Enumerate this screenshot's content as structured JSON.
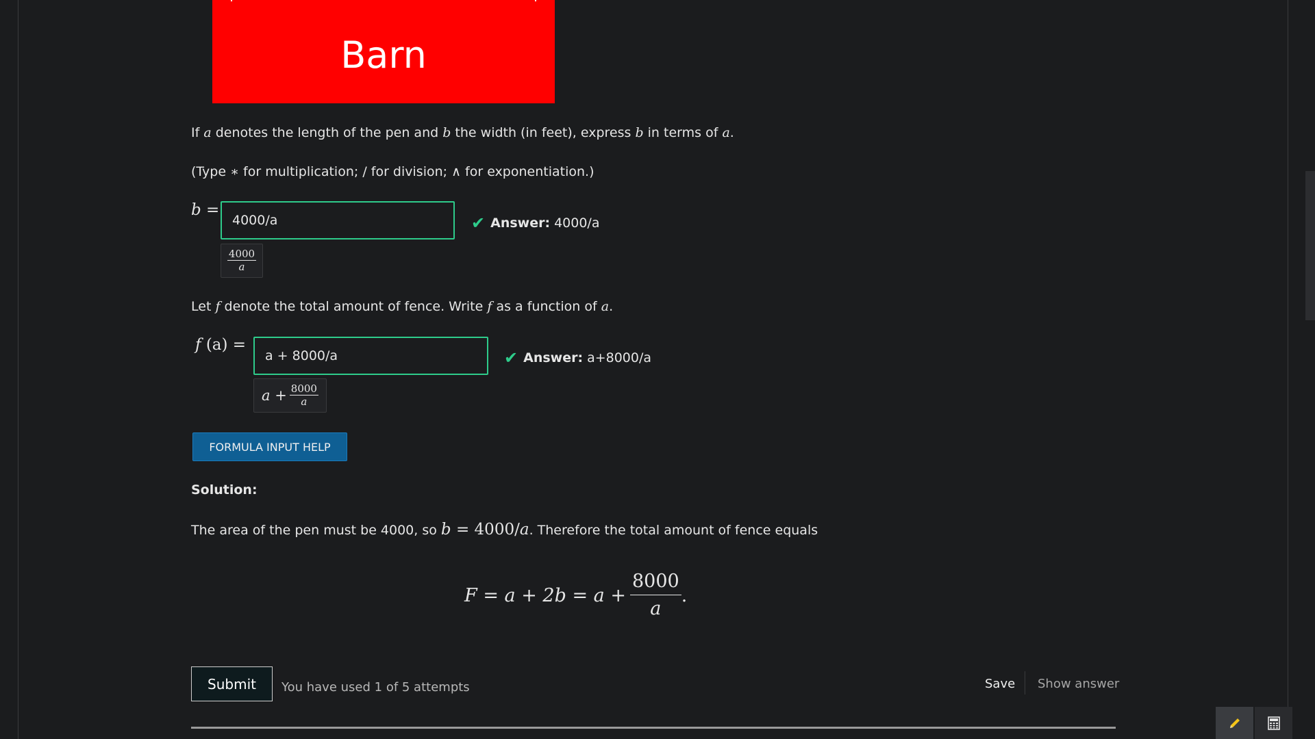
{
  "figure": {
    "label": "Barn"
  },
  "question1": {
    "prefix": "If ",
    "var_a": "a",
    "mid1": " denotes the length of the pen and ",
    "var_b": "b",
    "mid2": " the width (in feet), express ",
    "var_b2": "b",
    "mid3": " in terms of ",
    "var_a2": "a",
    "suffix": "."
  },
  "hint": {
    "prefix": "(Type ",
    "star": "∗",
    "mid1": " for multiplication; / for division; ",
    "caret": "∧",
    "mid2": " for exponentiation.)"
  },
  "part1": {
    "lhs_var": "b",
    "lhs_eq": " =",
    "input_value": "4000/a",
    "preview_num": "4000",
    "preview_den": "a",
    "answer_label": "Answer:",
    "answer_value": "4000/a"
  },
  "question2": {
    "prefix": "Let  ",
    "var_f": "f",
    "mid1": " denote the total amount of fence. Write  ",
    "var_f2": "f",
    "mid2": " as a function of ",
    "var_a": "a",
    "suffix": "."
  },
  "part2": {
    "lhs_f": "f",
    "lhs_rest": " (a) =",
    "input_value": "a + 8000/a",
    "preview_prefix": "a + ",
    "preview_num": "8000",
    "preview_den": "a",
    "answer_label": "Answer:",
    "answer_value": "a+8000/a"
  },
  "help_button": "FORMULA INPUT HELP",
  "solution": {
    "heading": "Solution:",
    "text_prefix": "The area of the pen must be 4000, so ",
    "eq_b": "b",
    "eq_rest": " = 4000/",
    "eq_a": "a",
    "text_suffix": ". Therefore the total amount of fence equals",
    "display_lhs": "F = a + 2b = a + ",
    "display_num": "8000",
    "display_den": "a",
    "display_end": "."
  },
  "footer": {
    "submit": "Submit",
    "attempts": "You have used 1 of 5 attempts",
    "save": "Save",
    "show_answer": "Show answer"
  },
  "icons": {
    "check": "check-icon",
    "pencil": "pencil-icon",
    "calculator": "calculator-icon"
  },
  "colors": {
    "barn": "#ff0000",
    "correct": "#2ecc8b",
    "help_button": "#0f5f94",
    "background": "#1b1c1e"
  }
}
